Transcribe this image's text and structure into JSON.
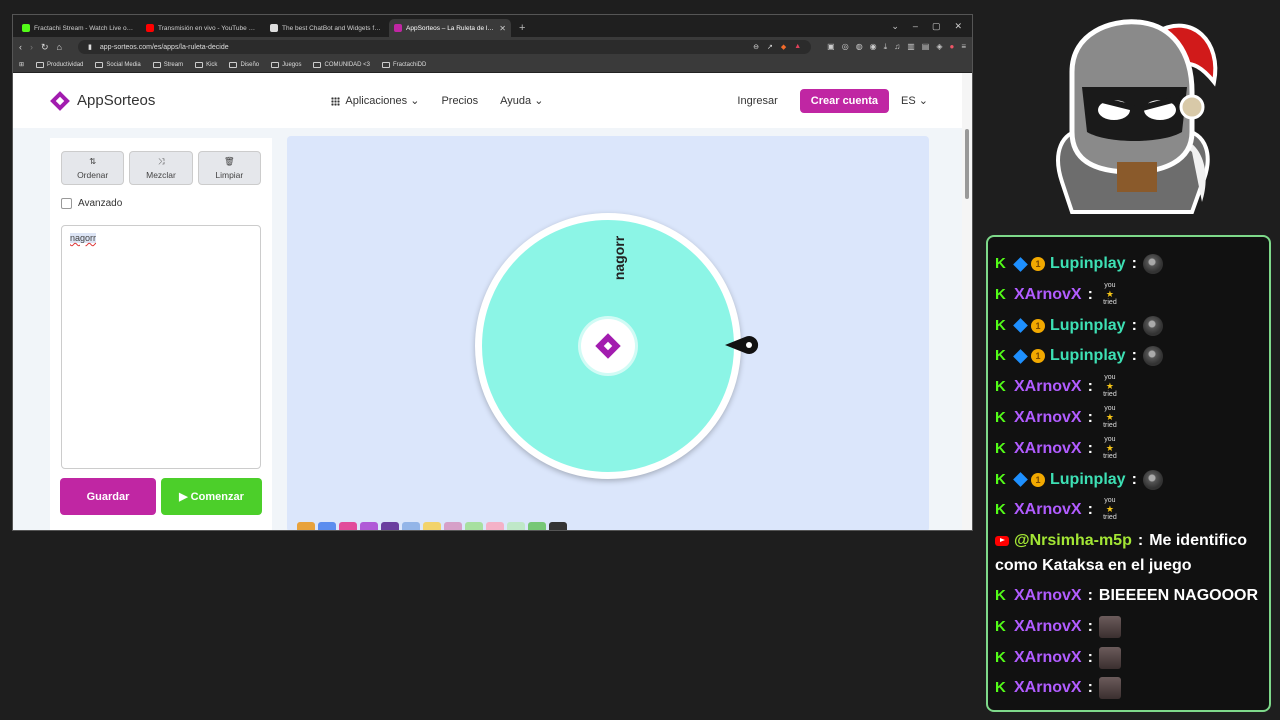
{
  "browser": {
    "tabs": [
      {
        "title": "Fractachi Stream - Watch Live on Kick",
        "color": "#53fc18",
        "active": false
      },
      {
        "title": "Transmisión en vivo - YouTube Studio",
        "color": "#ff0000",
        "active": false
      },
      {
        "title": "The best ChatBot and Widgets for Ki",
        "color": "#dddddd",
        "active": false
      },
      {
        "title": "AppSorteos – La Ruleta de la Su",
        "color": "#c026a3",
        "active": true
      }
    ],
    "url": "app-sorteos.com/es/apps/la-ruleta-decide",
    "bookmarks": [
      "Productividad",
      "Social Media",
      "Stream",
      "Kick",
      "Diseño",
      "Juegos",
      "COMUNIDAD <3",
      "FractachiDD"
    ]
  },
  "site": {
    "logo_text": "AppSorteos",
    "nav": {
      "apps": "Aplicaciones",
      "prices": "Precios",
      "help": "Ayuda"
    },
    "login": "Ingresar",
    "create_account": "Crear cuenta",
    "lang": "ES"
  },
  "panel": {
    "order": "Ordenar",
    "shuffle": "Mezclar",
    "clear": "Limpiar",
    "advanced": "Avanzado",
    "entries_text": "nagorr",
    "save": "Guardar",
    "start": "Comenzar"
  },
  "wheel": {
    "label": "nagorr",
    "color": "#8cf5e6"
  },
  "chat": {
    "messages": [
      {
        "platform": "kick",
        "badges": true,
        "user": "Lupinplay",
        "ucls": "u-lup",
        "emote": "sq"
      },
      {
        "platform": "kick",
        "badges": false,
        "user": "XArnovX",
        "ucls": "u-xar",
        "emote": "tried"
      },
      {
        "platform": "kick",
        "badges": true,
        "user": "Lupinplay",
        "ucls": "u-lup",
        "emote": "sq"
      },
      {
        "platform": "kick",
        "badges": true,
        "user": "Lupinplay",
        "ucls": "u-lup",
        "emote": "sq"
      },
      {
        "platform": "kick",
        "badges": false,
        "user": "XArnovX",
        "ucls": "u-xar",
        "emote": "tried"
      },
      {
        "platform": "kick",
        "badges": false,
        "user": "XArnovX",
        "ucls": "u-xar",
        "emote": "tried"
      },
      {
        "platform": "kick",
        "badges": false,
        "user": "XArnovX",
        "ucls": "u-xar",
        "emote": "tried"
      },
      {
        "platform": "kick",
        "badges": true,
        "user": "Lupinplay",
        "ucls": "u-lup",
        "emote": "sq"
      },
      {
        "platform": "kick",
        "badges": false,
        "user": "XArnovX",
        "ucls": "u-xar",
        "emote": "tried"
      },
      {
        "platform": "youtube",
        "badges": false,
        "user": "@Nrsimha-m5p",
        "ucls": "u-yt",
        "text": "Me identifico como Kataksa en el juego"
      },
      {
        "platform": "kick",
        "badges": false,
        "user": "XArnovX",
        "ucls": "u-xar",
        "text": "BIEEEEN NAGOOOR"
      },
      {
        "platform": "kick",
        "badges": false,
        "user": "XArnovX",
        "ucls": "u-xar",
        "emote": "face"
      },
      {
        "platform": "kick",
        "badges": false,
        "user": "XArnovX",
        "ucls": "u-xar",
        "emote": "face"
      },
      {
        "platform": "kick",
        "badges": false,
        "user": "XArnovX",
        "ucls": "u-xar",
        "emote": "face"
      }
    ],
    "emote_tried_text": [
      "you",
      "tried"
    ]
  }
}
